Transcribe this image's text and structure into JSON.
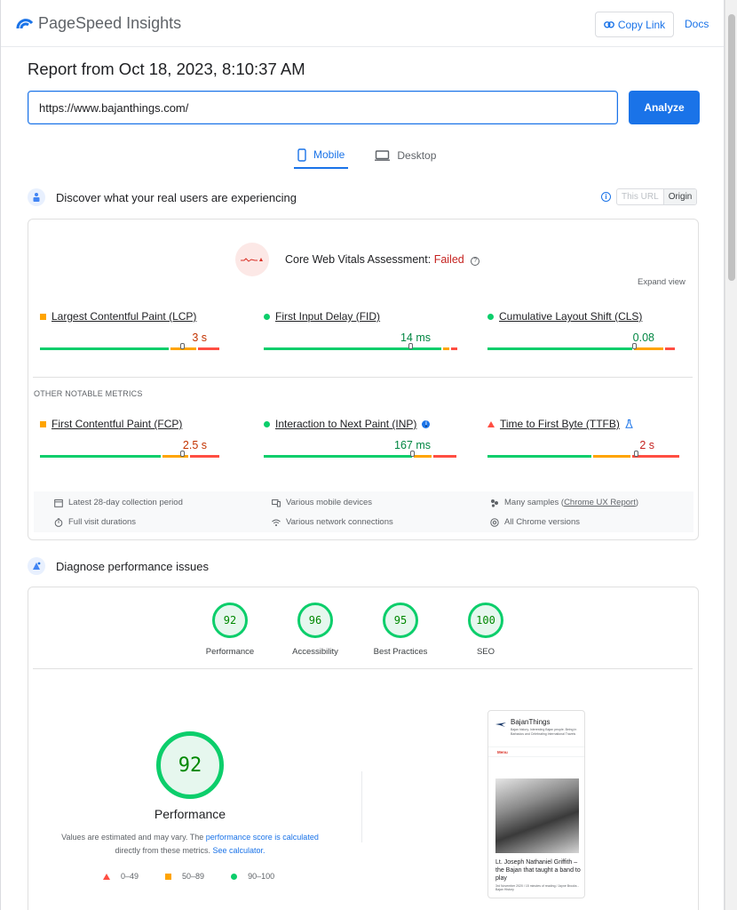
{
  "header": {
    "brand": "PageSpeed Insights",
    "copy_link": "Copy Link",
    "docs": "Docs"
  },
  "report": {
    "title": "Report from Oct 18, 2023, 8:10:37 AM",
    "url_value": "https://www.bajanthings.com/",
    "analyze": "Analyze"
  },
  "tabs": [
    {
      "label": "Mobile",
      "active": true
    },
    {
      "label": "Desktop",
      "active": false
    }
  ],
  "field": {
    "heading": "Discover what your real users are experiencing",
    "toggle": {
      "this_url": "This URL",
      "origin": "Origin"
    },
    "cwv_label": "Core Web Vitals Assessment:",
    "cwv_status": "Failed",
    "expand": "Expand view",
    "core_metrics": [
      {
        "name": "Largest Contentful Paint (LCP)",
        "value": "3 s",
        "rating": "needs-improvement",
        "bar": [
          0.66,
          0.13,
          0.11
        ],
        "marker": 0.72
      },
      {
        "name": "First Input Delay (FID)",
        "value": "14 ms",
        "rating": "good",
        "bar": [
          0.91,
          0.03,
          0.03
        ],
        "marker": 0.74
      },
      {
        "name": "Cumulative Layout Shift (CLS)",
        "value": "0.08",
        "rating": "good",
        "bar": [
          0.74,
          0.15,
          0.05
        ],
        "marker": 0.74
      }
    ],
    "other_label": "OTHER NOTABLE METRICS",
    "other_metrics": [
      {
        "name": "First Contentful Paint (FCP)",
        "value": "2.5 s",
        "rating": "needs-improvement",
        "bar": [
          0.62,
          0.13,
          0.15
        ],
        "marker": 0.72
      },
      {
        "name": "Interaction to Next Paint (INP)",
        "value": "167 ms",
        "rating": "good",
        "bar": [
          0.76,
          0.09,
          0.12
        ],
        "marker": 0.75
      },
      {
        "name": "Time to First Byte (TTFB)",
        "value": "2 s",
        "rating": "poor",
        "bar": [
          0.53,
          0.19,
          0.24
        ],
        "marker": 0.75
      }
    ],
    "info": {
      "period": "Latest 28-day collection period",
      "durations": "Full visit durations",
      "devices": "Various mobile devices",
      "network": "Various network connections",
      "samples_prefix": "Many samples (",
      "samples_link": "Chrome UX Report",
      "samples_suffix": ")",
      "chrome": "All Chrome versions"
    }
  },
  "lab": {
    "heading": "Diagnose performance issues",
    "scores": [
      {
        "label": "Performance",
        "score": "92"
      },
      {
        "label": "Accessibility",
        "score": "96"
      },
      {
        "label": "Best Practices",
        "score": "95"
      },
      {
        "label": "SEO",
        "score": "100"
      }
    ],
    "main_score": "92",
    "main_title": "Performance",
    "note_prefix": "Values are estimated and may vary. The ",
    "note_link1": "performance score is calculated",
    "note_mid": " directly from these metrics. ",
    "note_link2": "See calculator.",
    "legend": [
      {
        "range": "0–49",
        "shape": "triangle"
      },
      {
        "range": "50–89",
        "shape": "square"
      },
      {
        "range": "90–100",
        "shape": "circle"
      }
    ]
  },
  "preview": {
    "site_name": "BajanThings",
    "tagline": "Bajan history. Interesting Bajan people. Being in Barbados and Celebrating International Travels",
    "menu": "Menu",
    "headline": "Lt. Joseph Nathaniel Griffith – the Bajan that taught a band to play",
    "meta": "3rd November 2020 / 15 minutes of reading / Jayne Brooks - Bajan History"
  },
  "colors": {
    "accent": "#1a73e8",
    "good": "#0cce6b",
    "average": "#ffa400",
    "poor": "#ff4e42"
  }
}
